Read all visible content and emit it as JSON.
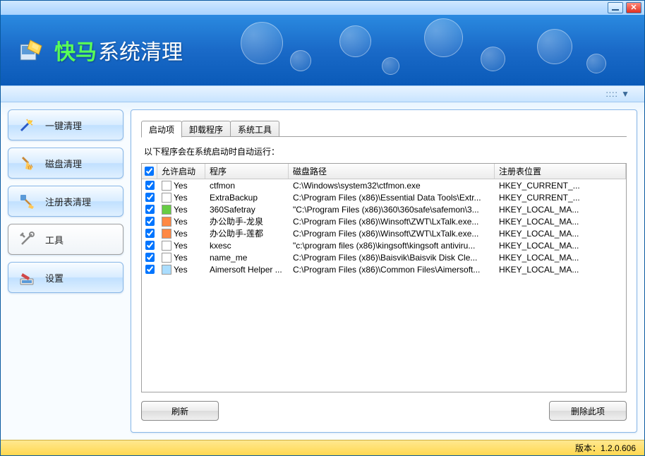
{
  "app": {
    "brand": "快马",
    "sub": "系统清理"
  },
  "sidebar": {
    "items": [
      {
        "label": "一键清理"
      },
      {
        "label": "磁盘清理"
      },
      {
        "label": "注册表清理"
      },
      {
        "label": "工具"
      },
      {
        "label": "设置"
      }
    ]
  },
  "tabs": [
    {
      "label": "启动项"
    },
    {
      "label": "卸载程序"
    },
    {
      "label": "系统工具"
    }
  ],
  "description": "以下程序会在系统启动时自动运行：",
  "columns": {
    "allow": "允许启动",
    "program": "程序",
    "path": "磁盘路径",
    "registry": "注册表位置"
  },
  "rows": [
    {
      "allow": "Yes",
      "program": "ctfmon",
      "path": "C:\\Windows\\system32\\ctfmon.exe",
      "registry": "HKEY_CURRENT_..."
    },
    {
      "allow": "Yes",
      "program": "ExtraBackup",
      "path": "C:\\Program Files (x86)\\Essential Data Tools\\Extr...",
      "registry": "HKEY_CURRENT_..."
    },
    {
      "allow": "Yes",
      "program": "360Safetray",
      "path": "\"C:\\Program Files (x86)\\360\\360safe\\safemon\\3...",
      "registry": "HKEY_LOCAL_MA..."
    },
    {
      "allow": "Yes",
      "program": "办公助手-龙泉",
      "path": "C:\\Program Files (x86)\\Winsoft\\ZWT\\LxTalk.exe...",
      "registry": "HKEY_LOCAL_MA..."
    },
    {
      "allow": "Yes",
      "program": "办公助手-莲都",
      "path": "C:\\Program Files (x86)\\Winsoft\\ZWT\\LxTalk.exe...",
      "registry": "HKEY_LOCAL_MA..."
    },
    {
      "allow": "Yes",
      "program": "kxesc",
      "path": "\"c:\\program files (x86)\\kingsoft\\kingsoft antiviru...",
      "registry": "HKEY_LOCAL_MA..."
    },
    {
      "allow": "Yes",
      "program": "name_me",
      "path": "C:\\Program Files (x86)\\Baisvik\\Baisvik Disk Cle...",
      "registry": "HKEY_LOCAL_MA..."
    },
    {
      "allow": "Yes",
      "program": "Aimersoft Helper ...",
      "path": "C:\\Program Files (x86)\\Common Files\\Aimersoft...",
      "registry": "HKEY_LOCAL_MA..."
    }
  ],
  "actions": {
    "refresh": "刷新",
    "delete": "删除此项"
  },
  "footer": {
    "version_label": "版本：",
    "version": "1.2.0.606"
  },
  "toolbar_dots": ":::: ▼"
}
